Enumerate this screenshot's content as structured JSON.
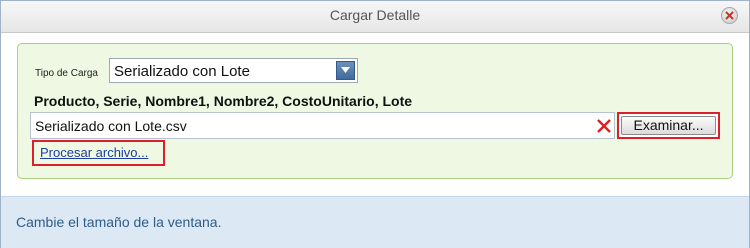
{
  "window": {
    "title": "Cargar Detalle",
    "close_icon": "close-icon"
  },
  "form": {
    "tipo_label": "Tipo de Carga",
    "tipo_value": "Serializado con Lote",
    "columns_text": "Producto, Serie, Nombre1, Nombre2, CostoUnitario, Lote",
    "file_value": "Serializado con Lote.csv",
    "clear_icon": "clear-x-icon",
    "browse_label": "Examinar...",
    "process_label": "Procesar archivo..."
  },
  "footer": {
    "text": "Cambie el tamaño de la ventana."
  },
  "colors": {
    "group_background": "#eef8e3",
    "group_border": "#a9cf84",
    "highlight_border": "#dd1e2d",
    "footer_background": "#dce9f4",
    "link_color": "#1f3f9c"
  }
}
